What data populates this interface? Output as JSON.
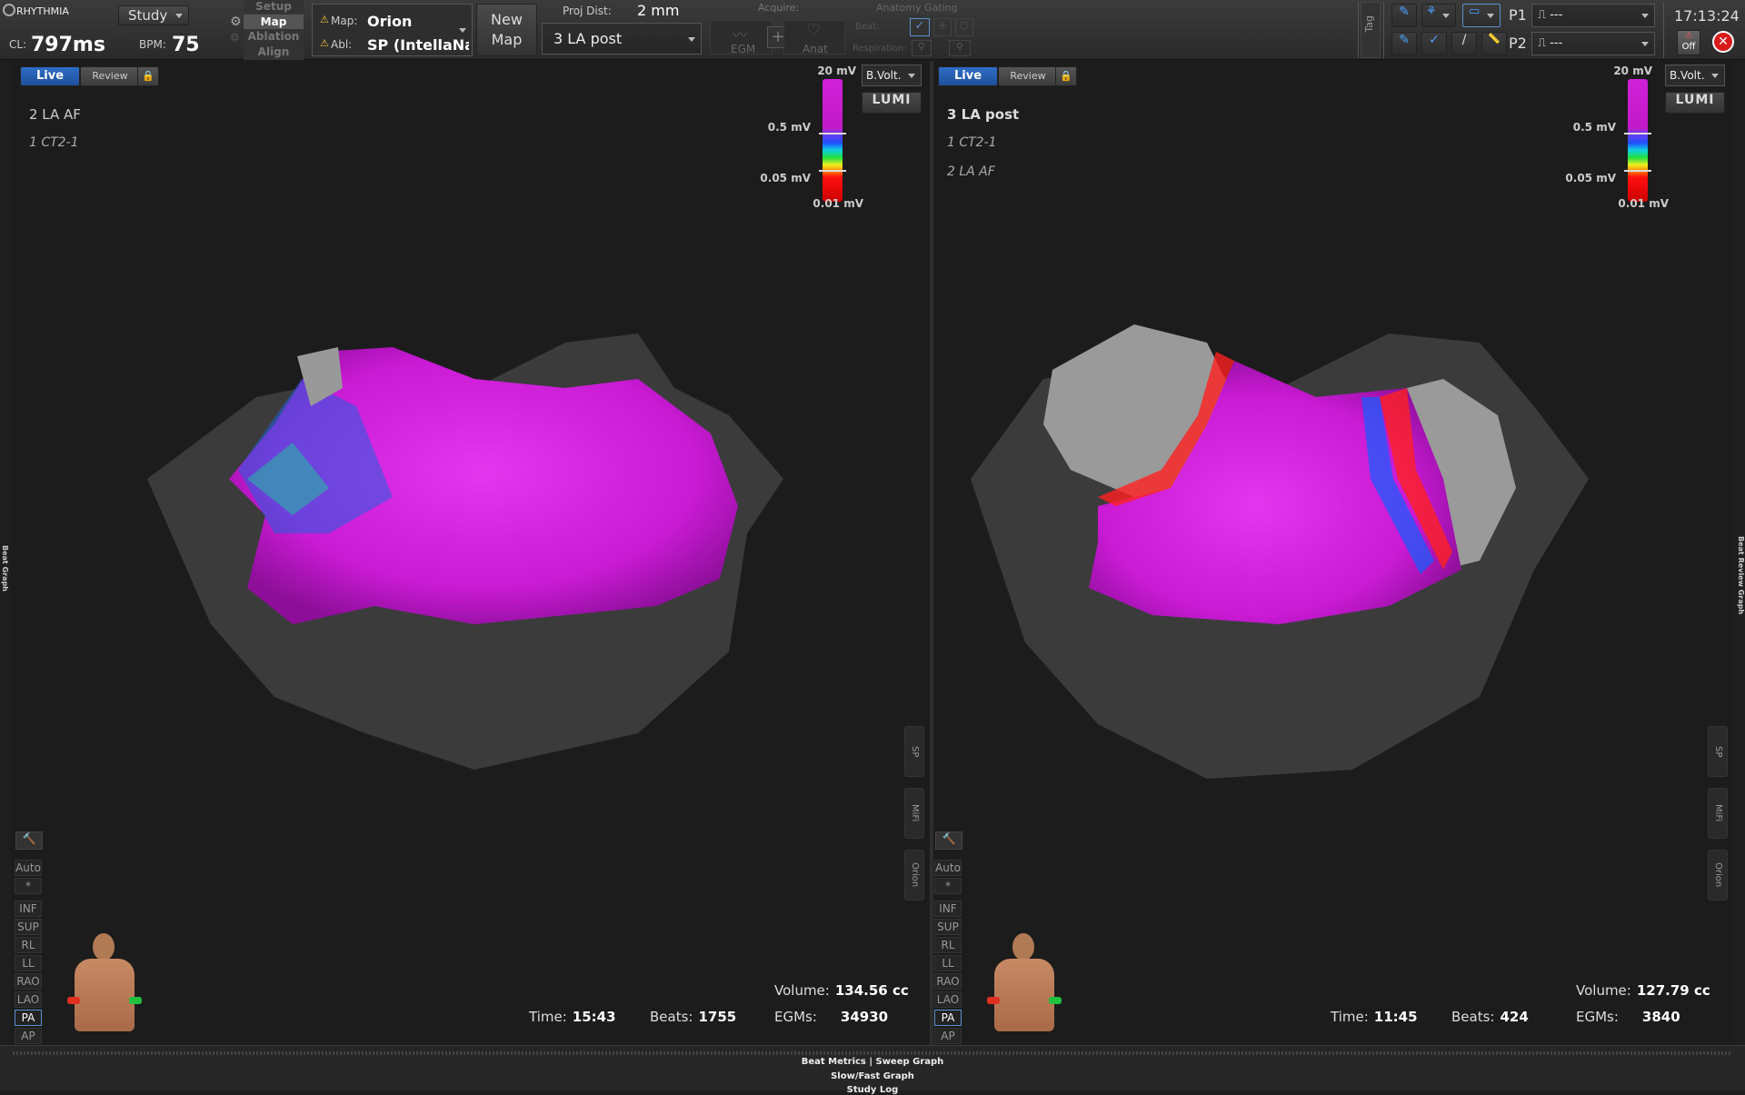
{
  "app": {
    "logo": "RHYTHMIA",
    "clock": "17:13:24",
    "study_btn": "Study",
    "cl_label": "CL:",
    "cl_value": "797ms",
    "bpm_label": "BPM:",
    "bpm_value": "75"
  },
  "modes": [
    "Setup",
    "Map",
    "Ablation",
    "Align"
  ],
  "map_info": {
    "map_label": "Map:",
    "map_value": "Orion",
    "abl_label": "Abl:",
    "abl_value": "SP (IntellaNa",
    "new_map_1": "New",
    "new_map_2": "Map",
    "proj_label": "Proj Dist:",
    "proj_value": "2 mm",
    "map_select": "3 LA post"
  },
  "acquire": {
    "label": "Acquire:",
    "egm": "EGM",
    "anat": "Anat"
  },
  "gating": {
    "label": "Anatomy Gating",
    "beat": "Beat:",
    "resp": "Respiration:"
  },
  "tag_label": "Tag",
  "probes": {
    "p1_label": "P1",
    "p1_value": "⎍ ---",
    "p2_label": "P2",
    "p2_value": "⎍ ---",
    "off_label": "Off"
  },
  "panels": [
    {
      "live": "Live",
      "review": "Review",
      "mode_select": "B.Volt.",
      "title": "2 LA AF",
      "subs": [
        "1 CT2-1"
      ],
      "scale": {
        "top": "20 mV",
        "hi": "0.5 mV",
        "lo": "0.05 mV",
        "bottom": "0.01 mV"
      },
      "stats": {
        "volume_label": "Volume:",
        "volume": "134.56 cc",
        "time_label": "Time:",
        "time": "15:43",
        "beats_label": "Beats:",
        "beats": "1755",
        "egms_label": "EGMs:",
        "egms": "34930"
      },
      "side_tabs": [
        "SP",
        "MiFi",
        "Orion"
      ]
    },
    {
      "live": "Live",
      "review": "Review",
      "mode_select": "B.Volt.",
      "title": "3 LA post",
      "subs": [
        "1 CT2-1",
        "2 LA AF"
      ],
      "scale": {
        "top": "20 mV",
        "hi": "0.5 mV",
        "lo": "0.05 mV",
        "bottom": "0.01 mV"
      },
      "stats": {
        "volume_label": "Volume:",
        "volume": "127.79 cc",
        "time_label": "Time:",
        "time": "11:45",
        "beats_label": "Beats:",
        "beats": "424",
        "egms_label": "EGMs:",
        "egms": "3840"
      },
      "side_tabs": [
        "SP",
        "MiFi",
        "Orion"
      ]
    }
  ],
  "view_buttons": [
    "Auto",
    "*",
    "INF",
    "SUP",
    "RL",
    "LL",
    "RAO",
    "LAO",
    "PA",
    "AP"
  ],
  "selected_view": "PA",
  "lumi_label": "LUMI",
  "side_labels": {
    "left": "Beat Graph",
    "right": "Beat Review Graph"
  },
  "bottom": {
    "line1": "Beat Metrics | Sweep Graph",
    "line2": "Slow/Fast Graph",
    "line3": "Study Log"
  }
}
